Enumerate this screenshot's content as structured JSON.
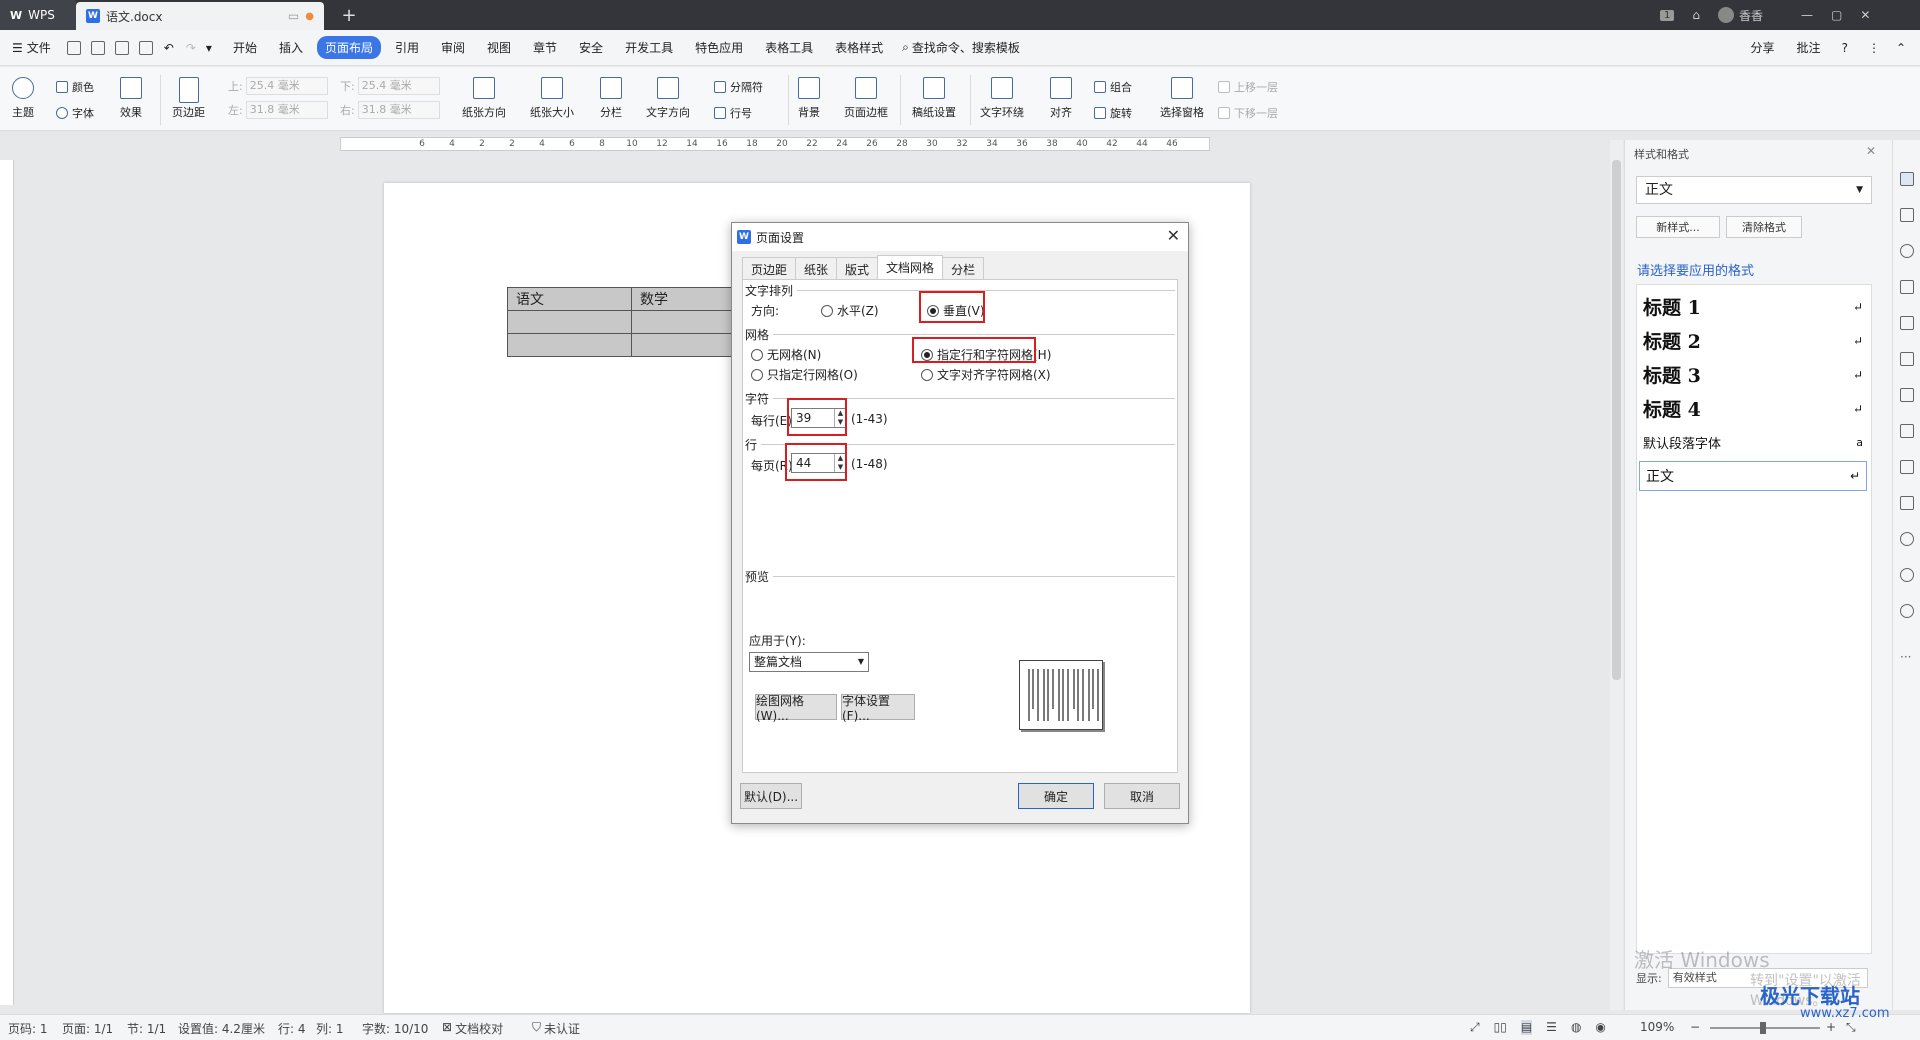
{
  "titlebar": {
    "app_name": "WPS",
    "doc_tab": "语文.docx",
    "new_tab": "+",
    "user": "香香"
  },
  "menubar": {
    "file": "文件",
    "items": [
      "开始",
      "插入",
      "页面布局",
      "引用",
      "审阅",
      "视图",
      "章节",
      "安全",
      "开发工具",
      "特色应用",
      "表格工具",
      "表格样式"
    ],
    "active": "页面布局",
    "search": "查找命令、搜索模板",
    "share": "分享",
    "comment": "批注"
  },
  "ribbon": {
    "theme": "主题",
    "color": "颜色",
    "font": "字体",
    "effect": "效果",
    "margins": "页边距",
    "top_label": "上:",
    "top_value": "25.4 毫米",
    "bottom_label": "下:",
    "bottom_value": "25.4 毫米",
    "left_label": "左:",
    "left_value": "31.8 毫米",
    "right_label": "右:",
    "right_value": "31.8 毫米",
    "orientation": "纸张方向",
    "size": "纸张大小",
    "columns": "分栏",
    "text_direction": "文字方向",
    "separator": "分隔符",
    "line_numbers": "行号",
    "background": "背景",
    "page_border": "页面边框",
    "manuscript": "稿纸设置",
    "text_wrap": "文字环绕",
    "align": "对齐",
    "group": "组合",
    "rotate": "旋转",
    "selection_pane": "选择窗格",
    "bring_forward": "上移一层",
    "send_backward": "下移一层"
  },
  "ruler": {
    "marks": [
      "6",
      "4",
      "2",
      "2",
      "4",
      "6",
      "8",
      "10",
      "12",
      "14",
      "16",
      "18",
      "20",
      "22",
      "24",
      "26",
      "28",
      "30",
      "32",
      "34",
      "36",
      "38",
      "40",
      "42",
      "44",
      "46"
    ]
  },
  "document": {
    "table": [
      [
        "语文",
        "数学"
      ],
      [
        "",
        ""
      ],
      [
        "",
        ""
      ],
      [
        "",
        ""
      ]
    ]
  },
  "dialog": {
    "title": "页面设置",
    "tabs": [
      "页边距",
      "纸张",
      "版式",
      "文档网格",
      "分栏"
    ],
    "active_tab": "文档网格",
    "text_arrangement": "文字排列",
    "direction_label": "方向:",
    "horizontal": "水平(Z)",
    "vertical": "垂直(V)",
    "grid_section": "网格",
    "no_grid": "无网格(N)",
    "line_grid_only": "只指定行网格(O)",
    "line_char_grid": "指定行和字符网格(H)",
    "align_char_grid": "文字对齐字符网格(X)",
    "char_section": "字符",
    "per_line_label": "每行(E):",
    "per_line_value": "39",
    "per_line_range": "(1-43)",
    "line_section": "行",
    "per_page_label": "每页(R):",
    "per_page_value": "44",
    "per_page_range": "(1-48)",
    "preview_section": "预览",
    "apply_to_label": "应用于(Y):",
    "apply_to_value": "整篇文档",
    "draw_grid_btn": "绘图网格(W)...",
    "font_settings_btn": "字体设置(F)...",
    "default_btn": "默认(D)...",
    "ok_btn": "确定",
    "cancel_btn": "取消"
  },
  "panel": {
    "title": "样式和格式",
    "current_style": "正文",
    "new_style": "新样式...",
    "clear_format": "清除格式",
    "apply_prompt": "请选择要应用的格式",
    "styles": [
      "标题 1",
      "标题 2",
      "标题 3",
      "标题 4",
      "默认段落字体",
      "正文"
    ],
    "show_label": "显示:",
    "show_value": "有效样式"
  },
  "statusbar": {
    "page_num": "页码: 1",
    "page": "页面: 1/1",
    "section": "节: 1/1",
    "setting": "设置值: 4.2厘米",
    "row": "行: 4",
    "col": "列: 1",
    "word_count": "字数: 10/10",
    "proofread": "文档校对",
    "unverified": "未认证",
    "zoom": "109%"
  },
  "watermark": {
    "line1": "激活 Windows",
    "line2": "转到\"设置\"以激活 Windows。",
    "site": "极光下载站",
    "url": "www.xz7.com"
  },
  "colors": {
    "accent": "#3a76e6",
    "highlight_box": "#d81e1e",
    "titlebar": "#33353a"
  }
}
